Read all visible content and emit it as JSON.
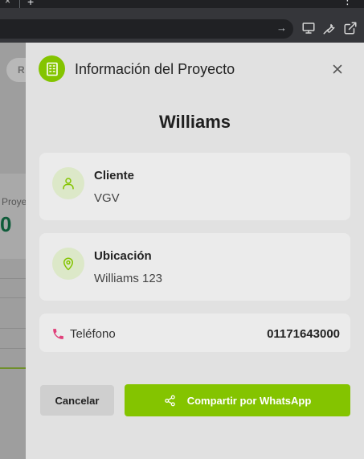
{
  "browser": {
    "tab_close_glyph": "×",
    "new_tab_glyph": "+",
    "menu_glyph": "⋮",
    "go_glyph": "→",
    "toolbar_icons": [
      "desktop-icon",
      "wrench-icon",
      "open-external-icon"
    ]
  },
  "background_page": {
    "pill_text": "R",
    "card_label": "Proye",
    "card_value": "0"
  },
  "modal": {
    "title": "Información del Proyecto",
    "header_icon": "building-icon",
    "close_glyph": "×",
    "project_name": "Williams",
    "client": {
      "label": "Cliente",
      "value": "VGV",
      "icon": "user-icon"
    },
    "location": {
      "label": "Ubicación",
      "value": "Williams 123",
      "icon": "map-pin-icon"
    },
    "phone": {
      "label": "Teléfono",
      "value": "01171643000",
      "icon": "phone-icon"
    },
    "buttons": {
      "cancel": "Cancelar",
      "share": "Compartir por WhatsApp",
      "share_icon": "share-icon"
    }
  },
  "colors": {
    "accent": "#84c400",
    "icon_circle_bg": "#dce8c8",
    "panel_bg": "#e1e1e1",
    "card_bg": "#ebebeb",
    "phone_icon": "#e0407a"
  }
}
